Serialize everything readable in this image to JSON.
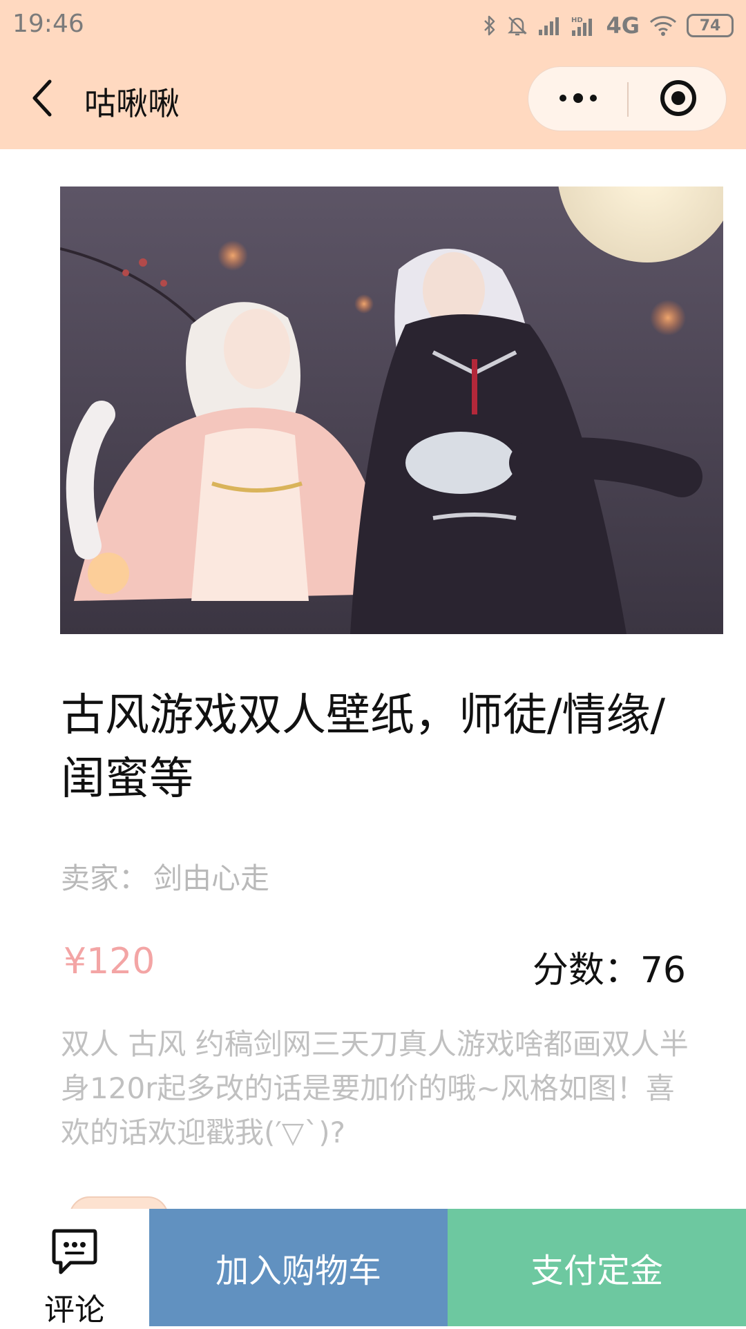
{
  "status_bar": {
    "time": "19:46",
    "network": "4G",
    "battery": "74",
    "icons": [
      "bluetooth-icon",
      "bell-off-icon",
      "signal-icon",
      "hd-signal-icon",
      "wifi-icon",
      "battery-icon"
    ]
  },
  "nav": {
    "title": "咕啾啾",
    "back_icon": "chevron-left-icon",
    "more_icon": "more-dots-icon",
    "close_icon": "target-close-icon"
  },
  "product": {
    "image_alt": "illustration-artwork",
    "title": "古风游戏双人壁纸，师徒/情缘/闺蜜等",
    "seller_label": "卖家：",
    "seller_name": "剑由心走",
    "price": "¥120",
    "score_label": "分数：",
    "score_value": "76",
    "description": "双人 古风 约稿剑网三天刀真人游戏啥都画双人半身120r起多改的话是要加价的哦~风格如图！喜欢的话欢迎戳我(′▽`)?"
  },
  "actions": {
    "comment_label": "评论",
    "comment_icon": "comment-bubble-icon",
    "cart_label": "加入购物车",
    "pay_label": "支付定金"
  },
  "colors": {
    "header_bg": "#ffd9c0",
    "price": "#f3a5a5",
    "cart_button": "#6191c0",
    "pay_button": "#6dc8a0"
  }
}
